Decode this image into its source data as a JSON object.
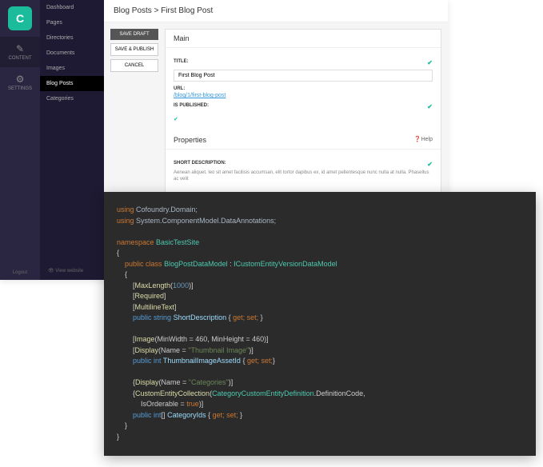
{
  "rail": {
    "content_label": "CONTENT",
    "settings_label": "SETTINGS",
    "logout_label": "Logout"
  },
  "sidebar": {
    "items": [
      "Dashboard",
      "Pages",
      "Directories",
      "Documents",
      "Images",
      "Blog Posts",
      "Categories"
    ],
    "view_website": "View website"
  },
  "breadcrumb": "Blog Posts > First Blog Post",
  "actions": {
    "save_draft": "SAVE DRAFT",
    "save_publish": "SAVE & PUBLISH",
    "cancel": "CANCEL"
  },
  "main_section": {
    "title": "Main",
    "title_label": "TITLE:",
    "title_value": "First Blog Post",
    "url_label": "URL:",
    "url_value": "/blog/1/first-blog-post",
    "published_label": "IS PUBLISHED:"
  },
  "properties_section": {
    "title": "Properties",
    "help": "Help",
    "short_desc_label": "SHORT DESCRIPTION:",
    "short_desc_value": "Aenean aliquet, leo sit amet facilisis accumsan, elit tortor dapibus ex, id amet pellentesque nunc nulla at nulla. Phasellus ac velit"
  },
  "code": {
    "line1_kw": "using",
    "line1_ns": "Cofoundry.Domain;",
    "line2_kw": "using",
    "line2_ns": "System.ComponentModel.DataAnnotations;",
    "line3_kw": "namespace",
    "line3_ns": "BasicTestSite",
    "line4_kw": "public class",
    "line4_cls": "BlogPostDataModel",
    "line4_impl": "ICustomEntityVersionDataModel",
    "attr_maxlength": "MaxLength",
    "maxlength_val": "1000",
    "attr_required": "Required",
    "attr_multiline": "MultilineText",
    "prop1_mod": "public string",
    "prop1_name": "ShortDescription",
    "getset": "get; set;",
    "attr_image": "Image",
    "image_params": "MinWidth = 460, MinHeight = 460",
    "attr_display": "Display",
    "display_name1": "\"Thumbnail Image\"",
    "prop2_mod": "public int",
    "prop2_name": "ThumbnailImageAssetId",
    "display_name2": "\"Categories\"",
    "attr_collection": "CustomEntityCollection",
    "collection_cls": "CategoryCustomEntityDefinition",
    "collection_prop": ".DefinitionCode,",
    "orderable": "IsOrderable = ",
    "true_val": "true",
    "prop3_mod": "public int",
    "prop3_name": "CategoryIds",
    "arr": "[]"
  }
}
